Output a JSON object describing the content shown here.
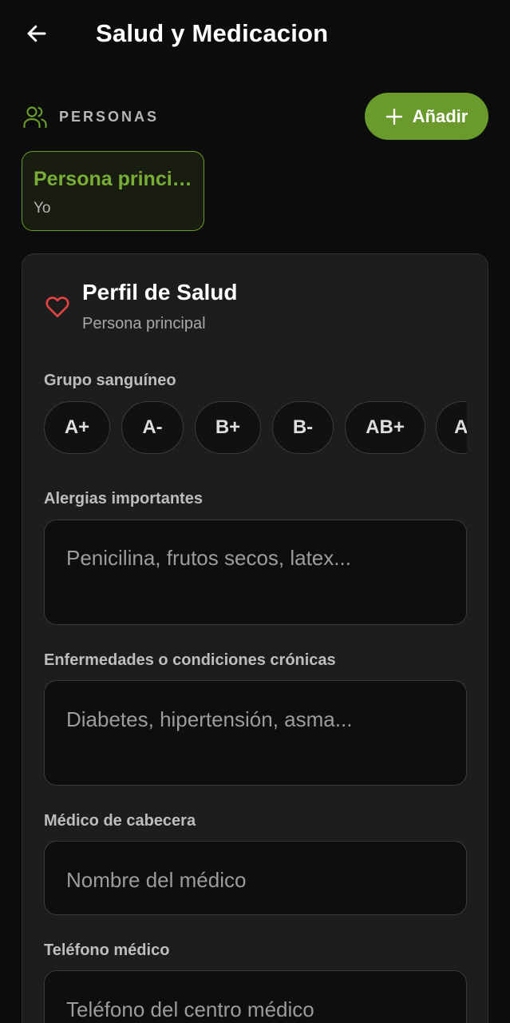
{
  "header": {
    "title": "Salud y Medicacion",
    "back_icon": "arrow-left-icon"
  },
  "persons": {
    "section_label": "PERSONAS",
    "section_icon": "people-icon",
    "add_button": {
      "label": "Añadir",
      "icon": "plus-icon"
    },
    "selected": {
      "name": "Persona principal",
      "relation": "Yo"
    }
  },
  "health_profile": {
    "title": "Perfil de Salud",
    "subtitle": "Persona principal",
    "icon": "heart-icon",
    "blood_group": {
      "label": "Grupo sanguíneo",
      "options": [
        "A+",
        "A-",
        "B+",
        "B-",
        "AB+",
        "AB-"
      ]
    },
    "allergies": {
      "label": "Alergias importantes",
      "placeholder": "Penicilina, frutos secos, latex..."
    },
    "conditions": {
      "label": "Enfermedades o condiciones crónicas",
      "placeholder": "Diabetes, hipertensión, asma..."
    },
    "doctor": {
      "label": "Médico de cabecera",
      "placeholder": "Nombre del médico"
    },
    "phone": {
      "label": "Teléfono médico",
      "placeholder": "Teléfono del centro médico"
    }
  },
  "colors": {
    "accent": "#6a9a2c",
    "accent_text": "#78ad36",
    "background": "#0c0c0c",
    "card": "#1d1d1d",
    "heart": "#e0433f"
  }
}
